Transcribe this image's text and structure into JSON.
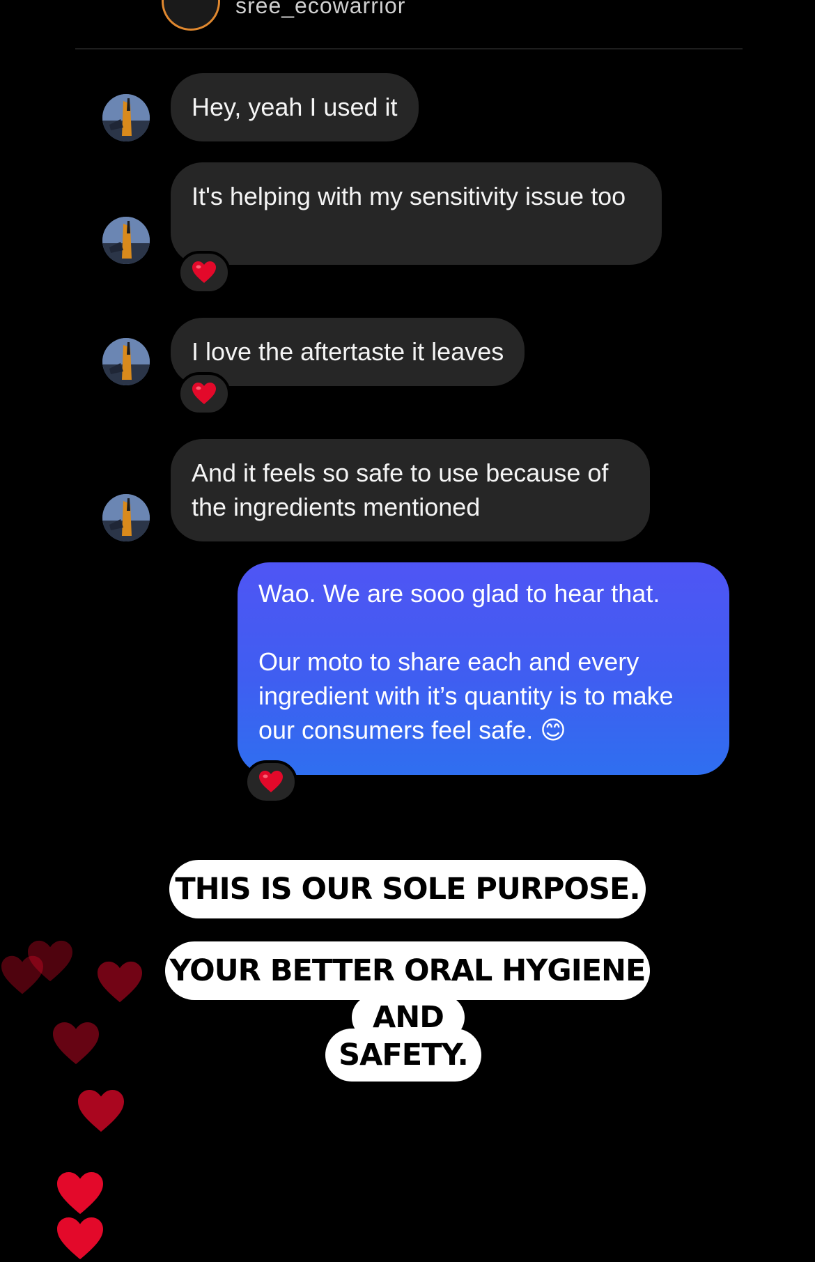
{
  "header": {
    "username": "sree_ecowarrior"
  },
  "messages": [
    {
      "from": "them",
      "text": "Hey, yeah I used it",
      "reaction": ""
    },
    {
      "from": "them",
      "text": "It's helping with my sensitivity issue too",
      "reaction": "❤️"
    },
    {
      "from": "them",
      "text": "I love the aftertaste it leaves",
      "reaction": "❤️"
    },
    {
      "from": "them",
      "text": "And it feels so safe to use because of the ingredients mentioned",
      "reaction": ""
    }
  ],
  "reply": {
    "paragraph_1": "Wao. We are sooo glad to hear that.",
    "paragraph_2": "Our moto to share each and every ingredient with it’s quantity is to make our consumers feel safe. 😊",
    "reaction": "❤️"
  },
  "overlay_text": {
    "line_1": "THIS IS OUR SOLE PURPOSE.",
    "line_2": "YOUR BETTER ORAL HYGIENE",
    "line_3": "AND",
    "line_4": "SAFETY."
  },
  "colors": {
    "sent_bubble": "#3f5ef1",
    "received_bubble": "#262626",
    "heart_red": "#e3092a"
  },
  "icons": [
    "avatar-image",
    "heart-reaction-icon",
    "floating-heart-icon"
  ]
}
